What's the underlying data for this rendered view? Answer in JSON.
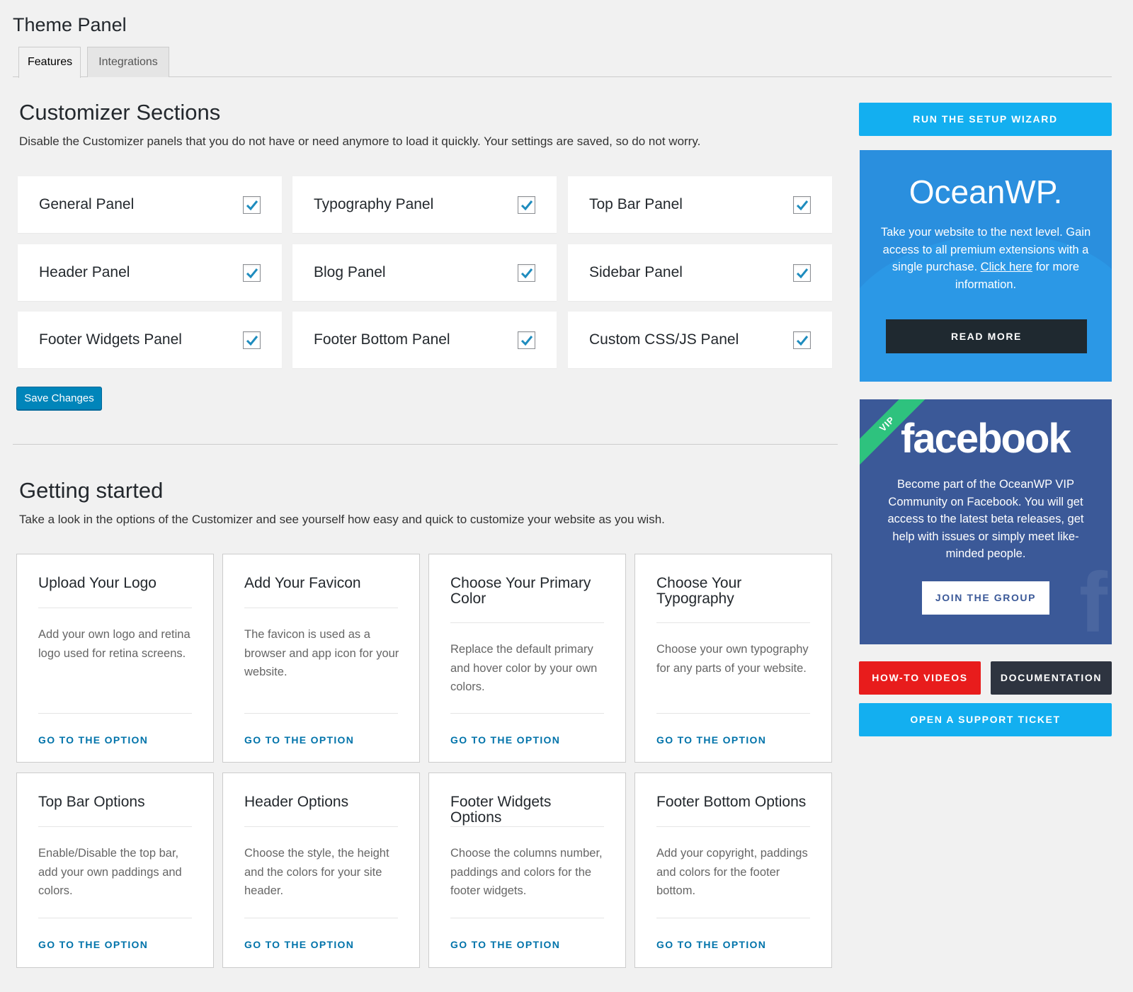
{
  "page_title": "Theme Panel",
  "tabs": [
    {
      "label": "Features",
      "active": true
    },
    {
      "label": "Integrations",
      "active": false
    }
  ],
  "customizer": {
    "heading": "Customizer Sections",
    "description": "Disable the Customizer panels that you do not have or need anymore to load it quickly. Your settings are saved, so do not worry.",
    "panels": [
      {
        "label": "General Panel",
        "checked": true
      },
      {
        "label": "Typography Panel",
        "checked": true
      },
      {
        "label": "Top Bar Panel",
        "checked": true
      },
      {
        "label": "Header Panel",
        "checked": true
      },
      {
        "label": "Blog Panel",
        "checked": true
      },
      {
        "label": "Sidebar Panel",
        "checked": true
      },
      {
        "label": "Footer Widgets Panel",
        "checked": true
      },
      {
        "label": "Footer Bottom Panel",
        "checked": true
      },
      {
        "label": "Custom CSS/JS Panel",
        "checked": true
      }
    ],
    "save_label": "Save Changes"
  },
  "getting_started": {
    "heading": "Getting started",
    "description": "Take a look in the options of the Customizer and see yourself how easy and quick to customize your website as you wish.",
    "link_label": "GO TO THE OPTION",
    "cards": [
      {
        "title": "Upload Your Logo",
        "text": "Add your own logo and retina logo used for retina screens."
      },
      {
        "title": "Add Your Favicon",
        "text": "The favicon is used as a browser and app icon for your website."
      },
      {
        "title": "Choose Your Primary Color",
        "text": "Replace the default primary and hover color by your own colors."
      },
      {
        "title": "Choose Your Typography",
        "text": "Choose your own typography for any parts of your website."
      },
      {
        "title": "Top Bar Options",
        "text": "Enable/Disable the top bar, add your own paddings and colors."
      },
      {
        "title": "Header Options",
        "text": "Choose the style, the height and the colors for your site header."
      },
      {
        "title": "Footer Widgets Options",
        "text": "Choose the columns number, paddings and colors for the footer widgets."
      },
      {
        "title": "Footer Bottom Options",
        "text": "Add your copyright, paddings and colors for the footer bottom."
      }
    ]
  },
  "sidebar": {
    "setup_wizard": "RUN THE SETUP WIZARD",
    "oceanwp": {
      "logo": "OceanWP.",
      "text_before_link": "Take your website to the next level. Gain access to all premium extensions with a single purchase. ",
      "link": "Click here",
      "text_after_link": " for more information.",
      "button": "READ MORE"
    },
    "facebook": {
      "ribbon": "VIP",
      "logo": "facebook",
      "text": "Become part of the OceanWP VIP Community on Facebook. You will get access to the latest beta releases, get help with issues or simply meet like-minded people.",
      "button": "JOIN THE GROUP"
    },
    "howto_videos": "HOW-TO VIDEOS",
    "documentation": "DOCUMENTATION",
    "support_ticket": "OPEN A SUPPORT TICKET"
  },
  "colors": {
    "accent_blue": "#13aff0",
    "wp_blue": "#0085ba",
    "link_blue": "#0073aa",
    "oceanwp_blue": "#2a8fde",
    "facebook_blue": "#3b5998",
    "video_red": "#e81c1c",
    "doc_dark": "#2e3440",
    "vip_green": "#2ec27e"
  }
}
